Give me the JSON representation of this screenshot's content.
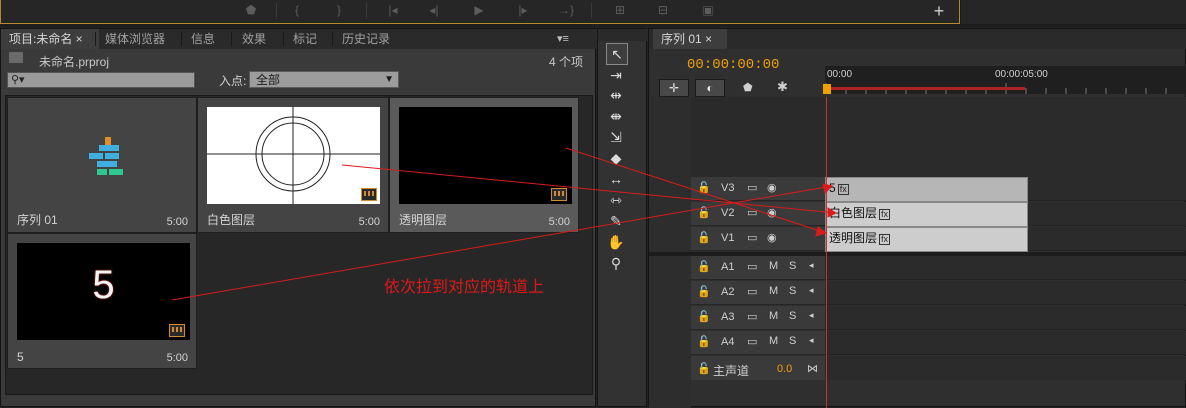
{
  "top_toolbar": {
    "buttons": [
      "marker-icon",
      "brace-left-icon",
      "brace-right-icon",
      "step-back-to-in-icon",
      "step-back-icon",
      "play-icon",
      "step-forward-icon",
      "step-to-out-icon",
      "insert-icon",
      "overwrite-icon",
      "camera-icon"
    ],
    "add_label": "+"
  },
  "project": {
    "tabs": [
      {
        "label": "项目:未命名 ×",
        "active": true
      },
      {
        "label": "媒体浏览器",
        "active": false
      },
      {
        "label": "信息",
        "active": false
      },
      {
        "label": "效果",
        "active": false
      },
      {
        "label": "标记",
        "active": false
      },
      {
        "label": "历史记录",
        "active": false
      }
    ],
    "menu_label": "▾≡",
    "filename": "未命名.prproj",
    "item_count": "4 个项",
    "search_placeholder": "",
    "inpoint_label": "入点:",
    "inpoint_value": "全部",
    "items": [
      {
        "name": "序列 01",
        "duration": "5:00"
      },
      {
        "name": "白色图层",
        "duration": "5:00"
      },
      {
        "name": "透明图层",
        "duration": "5:00"
      },
      {
        "name": "5",
        "duration": "5:00",
        "thumb_text": "5"
      }
    ]
  },
  "tools": [
    "selection-tool-icon",
    "track-select-tool-icon",
    "ripple-edit-tool-icon",
    "rolling-edit-tool-icon",
    "rate-stretch-tool-icon",
    "razor-tool-icon",
    "slip-tool-icon",
    "slide-tool-icon",
    "pen-tool-icon",
    "hand-tool-icon",
    "zoom-tool-icon"
  ],
  "timeline": {
    "tab_label": "序列 01 ×",
    "timecode": "00:00:00:00",
    "ruler": [
      "00:00",
      "00:00:05:00"
    ],
    "video_tracks": [
      {
        "name": "V3",
        "clip": "5"
      },
      {
        "name": "V2",
        "clip": "白色图层"
      },
      {
        "name": "V1",
        "clip": "透明图层"
      }
    ],
    "audio_tracks": [
      {
        "name": "A1",
        "m": "M",
        "s": "S"
      },
      {
        "name": "A2",
        "m": "M",
        "s": "S"
      },
      {
        "name": "A3",
        "m": "M",
        "s": "S"
      },
      {
        "name": "A4",
        "m": "M",
        "s": "S"
      }
    ],
    "master": {
      "name": "主声道",
      "value": "0.0"
    }
  },
  "annotation": {
    "text": "依次拉到对应的轨道上",
    "color": "#e01818"
  },
  "colors": {
    "accent": "#f0a000",
    "playhead": "#c83232"
  }
}
